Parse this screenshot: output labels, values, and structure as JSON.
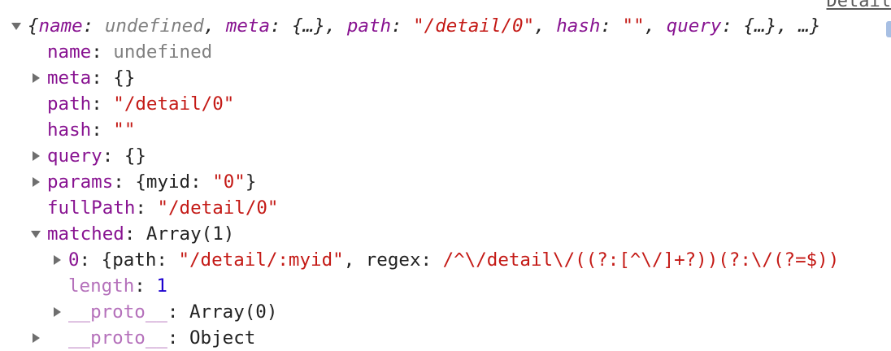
{
  "source_link": "Detail",
  "summary": {
    "open": "{",
    "k_name": "name",
    "v_name": "undefined",
    "k_meta": "meta",
    "v_meta": "{…}",
    "k_path": "path",
    "v_path": "\"/detail/0\"",
    "k_hash": "hash",
    "v_hash": "\"\"",
    "k_query": "query",
    "v_query": "{…}",
    "tail": "…}",
    "colon": ": ",
    "comma": ", "
  },
  "props": {
    "name": {
      "key": "name",
      "value": "undefined"
    },
    "meta": {
      "key": "meta",
      "value": "{}"
    },
    "path": {
      "key": "path",
      "value": "\"/detail/0\""
    },
    "hash": {
      "key": "hash",
      "value": "\"\""
    },
    "query": {
      "key": "query",
      "value": "{}"
    },
    "params": {
      "key": "params",
      "open": "{",
      "inner_key": "myid",
      "inner_value": "\"0\"",
      "close": "}"
    },
    "fullPath": {
      "key": "fullPath",
      "value": "\"/detail/0\""
    },
    "matched": {
      "key": "matched",
      "value": "Array(1)"
    },
    "item0": {
      "key": "0",
      "open": "{",
      "k_path": "path",
      "v_path": "\"/detail/:myid\"",
      "k_regex": "regex",
      "v_regex": "/^\\/detail\\/((?:[^\\/]+?))(?:\\/(?=$))"
    },
    "length": {
      "key": "length",
      "value": "1"
    },
    "proto_array": {
      "key": "__proto__",
      "value": "Array(0)"
    },
    "proto_object": {
      "key": "__proto__",
      "value": "Object"
    }
  },
  "sep": ": "
}
